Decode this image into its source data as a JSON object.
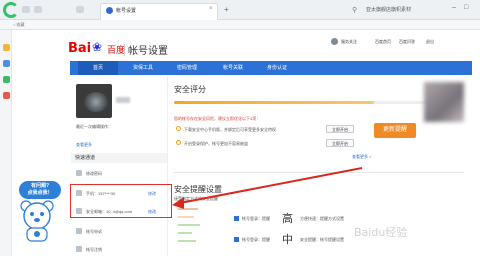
{
  "browser": {
    "tab_title": "帐号设置",
    "search_text": "亚太旗舰店旗帜素材",
    "addr_text": "⌂ 收藏",
    "new_tab": "+",
    "tab_close": "×"
  },
  "header": {
    "logo_bai": "Bai",
    "logo_du": "百度",
    "subtitle": "帐号设置",
    "links": [
      "服务关注",
      "百度首页",
      "百度问答",
      "退出"
    ]
  },
  "nav": {
    "items": [
      "首页",
      "资保工具",
      "密码管理",
      "帐号关联",
      "身份认证"
    ]
  },
  "profile": {
    "lines": [
      "最近一次编辑操作：",
      "查看更多"
    ],
    "quick_title": "快速通道",
    "quick_items": [
      "修改密码",
      "手机：157****30",
      "安全邮箱：10..4@qq.com",
      "帐号申诉",
      "帐号注销"
    ],
    "edit_label": "修改"
  },
  "mascot": {
    "line1": "有问题?",
    "line2": "点我点我！"
  },
  "main": {
    "score_title": "安全评分",
    "score_desc": "您的帐号存在安全风险，建议立即优化以下3项：",
    "update_btn": "更新提醒",
    "warn1": "下载安全中心手机版，并绑定后可享受更多安全特权",
    "warn2": "开启登录保护，帐号更加不容易被盗",
    "btn_open": "立即开启",
    "btn_bind": "立即开启",
    "more_link": "查看更多 >",
    "remind_title": "安全提醒设置",
    "remind_sub": "接受指定方式的安全提醒",
    "opt1": "帐号登录：提醒",
    "opt2": "帐号登录：提醒",
    "level_hi": "高",
    "level_mid": "中",
    "right_text1": "方便快速：提醒方式设置",
    "right_text2": "安全提醒：帐号提醒设置"
  },
  "watermark": "Baidu经验"
}
